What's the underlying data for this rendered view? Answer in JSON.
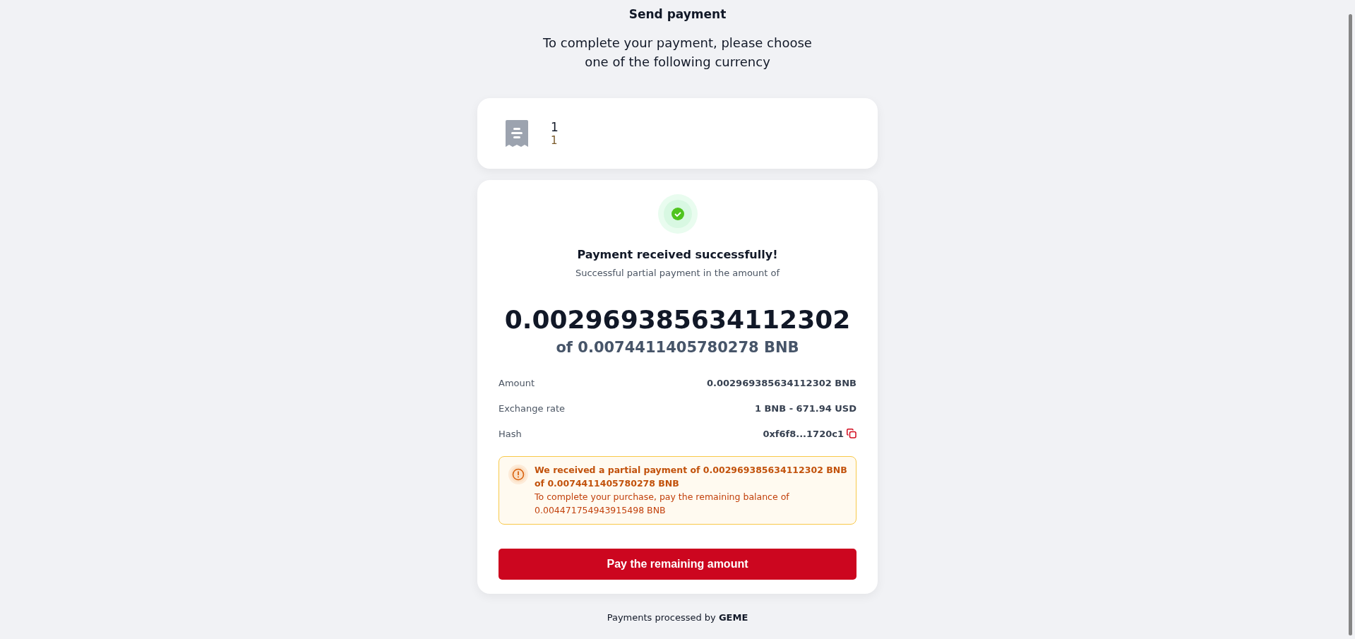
{
  "header": {
    "title": "Send payment",
    "subtitle": "To complete your payment, please choose one of the following currency"
  },
  "order": {
    "line_1": "1",
    "line_2": "1"
  },
  "status": {
    "title": "Payment received successfully!",
    "subtitle": "Successful partial payment in the amount of",
    "amount": "0.002969385634112302",
    "total": "of 0.0074411405780278 BNB"
  },
  "details": [
    {
      "label": "Amount",
      "value": "0.002969385634112302 BNB",
      "kind": "text"
    },
    {
      "label": "Exchange rate",
      "value": "1 BNB - 671.94 USD",
      "kind": "text"
    },
    {
      "label": "Hash",
      "value": "0xf6f8...1720c1",
      "kind": "copy"
    }
  ],
  "alert": {
    "title": "We received a partial payment of 0.002969385634112302 BNB of 0.0074411405780278 BNB",
    "text": "To complete your purchase, pay the remaining balance of 0.004471754943915498 BNB"
  },
  "button": "Pay the remaining amount",
  "footer": "Payments processed by **GEME**"
}
